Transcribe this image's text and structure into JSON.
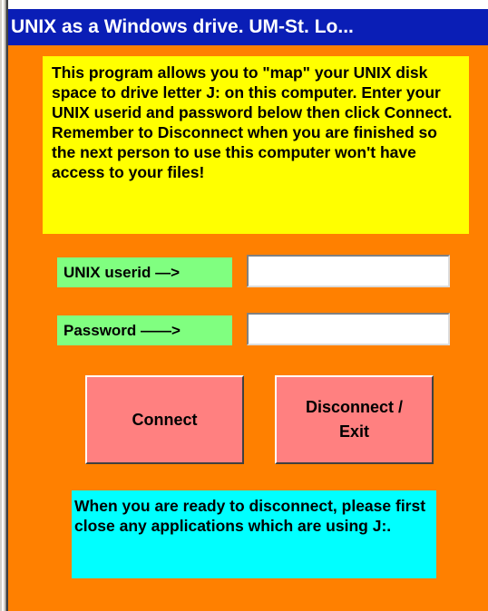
{
  "window": {
    "title": "UNIX as a Windows drive.   UM-St. Lo..."
  },
  "info_top": {
    "text": "This program allows you to \"map\" your UNIX disk space to drive letter J: on this computer.  Enter your UNIX userid and password below then click Connect. Remember to Disconnect when you are finished so the next person to use this computer won't have access to your files!"
  },
  "form": {
    "userid_label": "UNIX userid  —>",
    "userid_value": "",
    "password_label": "Password  ——>",
    "password_value": ""
  },
  "buttons": {
    "connect_label": "Connect",
    "disconnect_label": "Disconnect /\nExit"
  },
  "info_bottom": {
    "text": "When you are ready to disconnect, please first close any applications which are using J:."
  },
  "colors": {
    "title_bar": "#0a1eb6",
    "background": "#ff8000",
    "info_top": "#ffff00",
    "label": "#80ff80",
    "button": "#ff8080",
    "info_bottom": "#00ffff"
  }
}
